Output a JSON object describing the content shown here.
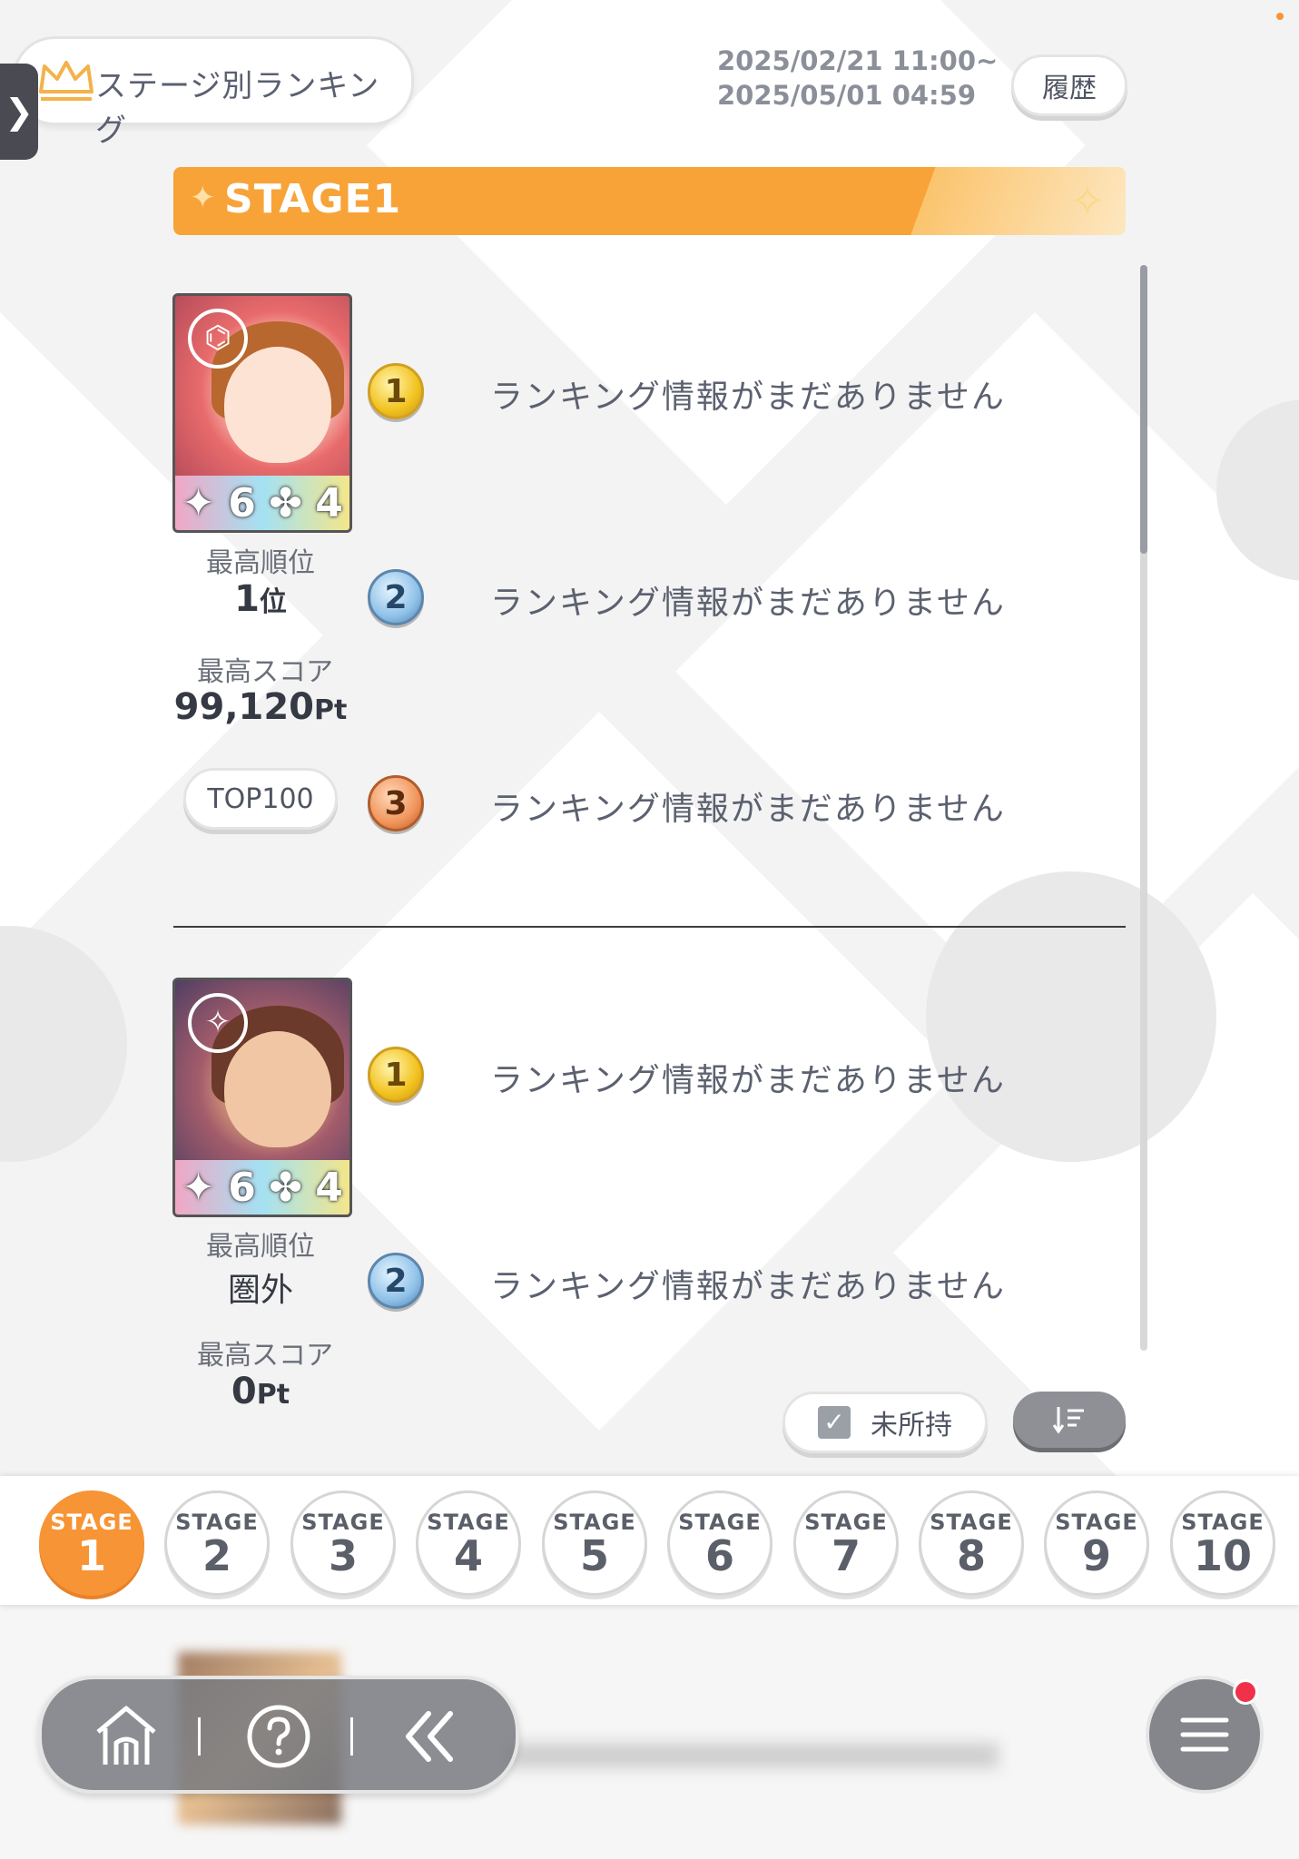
{
  "header": {
    "title": "ステージ別ランキング",
    "period_start": "2025/02/21 11:00~",
    "period_end": "2025/05/01 04:59",
    "history_label": "履歴"
  },
  "stage_header": {
    "label": "STAGE1"
  },
  "entries": [
    {
      "card_rarity": "6",
      "card_level": "4",
      "best_rank_label": "最高順位",
      "best_rank_value": "1",
      "best_rank_unit": "位",
      "best_score_label": "最高スコア",
      "best_score_value": "99,120",
      "best_score_unit": "Pt",
      "top_button": "TOP100",
      "rankings": [
        {
          "rank": "1",
          "text": "ランキング情報がまだありません"
        },
        {
          "rank": "2",
          "text": "ランキング情報がまだありません"
        },
        {
          "rank": "3",
          "text": "ランキング情報がまだありません"
        }
      ]
    },
    {
      "card_rarity": "6",
      "card_level": "4",
      "best_rank_label": "最高順位",
      "best_rank_value": "圏外",
      "best_score_label": "最高スコア",
      "best_score_value": "0",
      "best_score_unit": "Pt",
      "rankings": [
        {
          "rank": "1",
          "text": "ランキング情報がまだありません"
        },
        {
          "rank": "2",
          "text": "ランキング情報がまだありません"
        }
      ]
    }
  ],
  "filter": {
    "unowned_label": "未所持",
    "unowned_checked": true
  },
  "stages": [
    {
      "prefix": "STAGE",
      "number": "1",
      "active": true
    },
    {
      "prefix": "STAGE",
      "number": "2"
    },
    {
      "prefix": "STAGE",
      "number": "3"
    },
    {
      "prefix": "STAGE",
      "number": "4"
    },
    {
      "prefix": "STAGE",
      "number": "5"
    },
    {
      "prefix": "STAGE",
      "number": "6"
    },
    {
      "prefix": "STAGE",
      "number": "7"
    },
    {
      "prefix": "STAGE",
      "number": "8"
    },
    {
      "prefix": "STAGE",
      "number": "9"
    },
    {
      "prefix": "STAGE",
      "number": "10"
    }
  ],
  "nav": {
    "icons": [
      "home-icon",
      "help-icon",
      "back-icon",
      "menu-icon"
    ],
    "has_notification": true
  },
  "colors": {
    "accent": "#f79435",
    "header_gradient_start": "#f8a338",
    "notification": "#f0314a"
  }
}
